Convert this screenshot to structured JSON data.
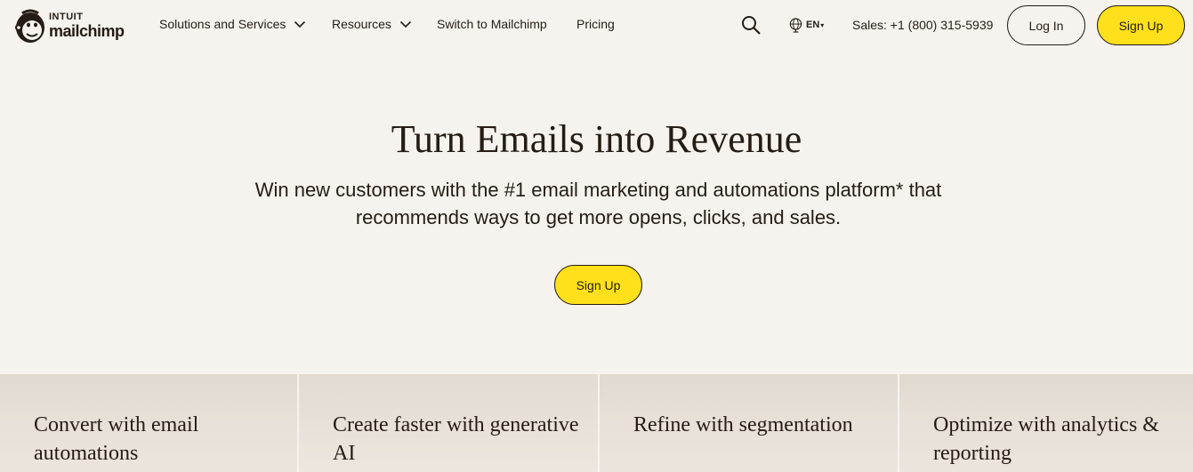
{
  "brand": {
    "intuit": "INTUIT",
    "name": "mailchimp"
  },
  "nav": {
    "solutions": "Solutions and Services",
    "resources": "Resources",
    "switch": "Switch to Mailchimp",
    "pricing": "Pricing"
  },
  "header": {
    "language": "EN",
    "sales": "Sales: +1 (800) 315-5939",
    "login": "Log In",
    "signup": "Sign Up"
  },
  "hero": {
    "title": "Turn Emails into Revenue",
    "subtitle": "Win new customers with the #1 email marketing and automations platform* that recommends ways to get more opens, clicks, and sales.",
    "cta": "Sign Up"
  },
  "features": [
    {
      "title": "Convert with email automations"
    },
    {
      "title": "Create faster with generative AI"
    },
    {
      "title": "Refine with segmentation"
    },
    {
      "title": "Optimize with analytics & reporting"
    }
  ],
  "colors": {
    "accent": "#ffe01b",
    "text": "#241c15",
    "background": "#f6f3ee"
  },
  "icons": {
    "logo": "freddie-chimp-icon",
    "search": "search-icon",
    "language": "globe-icon",
    "dropdown": "chevron-down-icon"
  }
}
